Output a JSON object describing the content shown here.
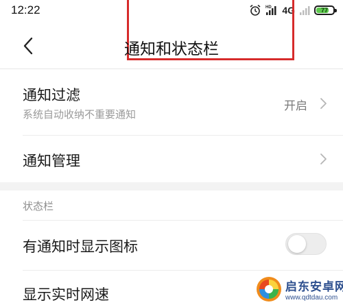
{
  "status_bar": {
    "time": "12:22",
    "network_label": "4G",
    "network_sub": "HD",
    "battery_level": 77,
    "battery_text": "77"
  },
  "header": {
    "title": "通知和状态栏"
  },
  "rows": {
    "notification_filter": {
      "title": "通知过滤",
      "subtitle": "系统自动收纳不重要通知",
      "value": "开启"
    },
    "notification_management": {
      "title": "通知管理"
    }
  },
  "status_bar_section": {
    "header": "状态栏",
    "show_icons_title": "有通知时显示图标",
    "show_icons_enabled": false,
    "realtime_speed_title": "显示实时网速"
  },
  "watermark": {
    "title": "启东安卓网",
    "url": "www.qdtdau.com"
  },
  "colors": {
    "annotation": "#d62b2b",
    "battery_fill": "#5ec84e",
    "watermark": "#2d4f8e"
  }
}
